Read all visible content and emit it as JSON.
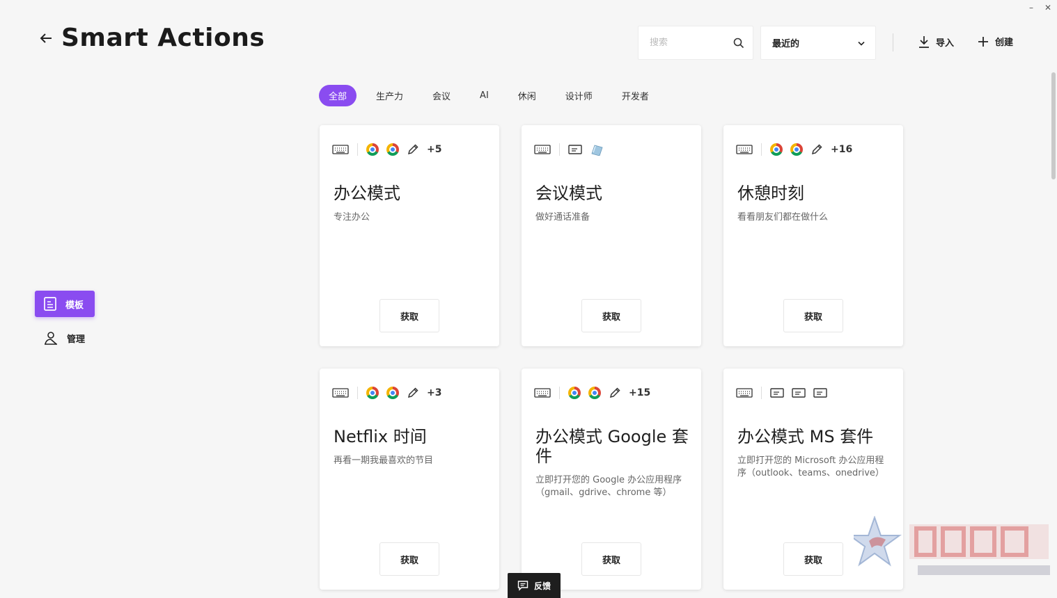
{
  "window": {
    "minimize_glyph": "–",
    "close_glyph": "✕"
  },
  "header": {
    "title": "Smart Actions",
    "back_icon": "arrow-left-icon",
    "search_placeholder": "搜索",
    "sort_value": "最近的",
    "import_label": "导入",
    "create_label": "创建"
  },
  "sidebar": {
    "items": [
      {
        "label": "模板",
        "icon": "template-icon",
        "active": true
      },
      {
        "label": "管理",
        "icon": "manage-icon",
        "active": false
      }
    ]
  },
  "tabs": [
    {
      "label": "全部",
      "active": true
    },
    {
      "label": "生产力"
    },
    {
      "label": "会议"
    },
    {
      "label": "AI"
    },
    {
      "label": "休闲"
    },
    {
      "label": "设计师"
    },
    {
      "label": "开发者"
    }
  ],
  "cards": [
    {
      "title": "办公模式",
      "desc": "专注办公",
      "icons": [
        "keyboard-icon",
        "chrome-icon",
        "chrome-icon",
        "pencil-icon"
      ],
      "more": "+5",
      "button": "获取"
    },
    {
      "title": "会议模式",
      "desc": "做好通话准备",
      "icons": [
        "keyboard-icon",
        "window-icon",
        "app-icon"
      ],
      "more": "",
      "button": "获取"
    },
    {
      "title": "休憩时刻",
      "desc": "看看朋友们都在做什么",
      "icons": [
        "keyboard-icon",
        "chrome-icon",
        "chrome-icon",
        "pencil-icon"
      ],
      "more": "+16",
      "button": "获取"
    },
    {
      "title": "Netflix 时间",
      "desc": "再看一期我最喜欢的节目",
      "icons": [
        "keyboard-icon",
        "chrome-icon",
        "chrome-icon",
        "pencil-icon"
      ],
      "more": "+3",
      "button": "获取"
    },
    {
      "title": "办公模式 Google 套件",
      "desc": "立即打开您的 Google 办公应用程序（gmail、gdrive、chrome 等）",
      "icons": [
        "keyboard-icon",
        "chrome-icon",
        "chrome-icon",
        "pencil-icon"
      ],
      "more": "+15",
      "button": "获取"
    },
    {
      "title": "办公模式 MS 套件",
      "desc": "立即打开您的 Microsoft 办公应用程序（outlook、teams、onedrive）",
      "icons": [
        "keyboard-icon",
        "window-icon",
        "window-icon",
        "window-icon"
      ],
      "more": "",
      "button": "获取"
    }
  ],
  "feedback": {
    "label": "反馈"
  },
  "colors": {
    "accent": "#8a4cf0",
    "background": "#f6f6f6",
    "card": "#ffffff"
  }
}
